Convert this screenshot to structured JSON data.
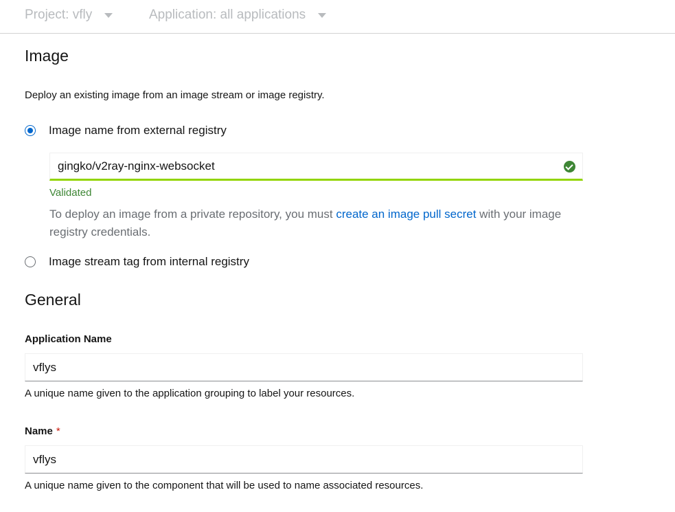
{
  "topbar": {
    "project_label": "Project: vfly",
    "application_label": "Application: all applications"
  },
  "image_section": {
    "title": "Image",
    "description": "Deploy an existing image from an image stream or image registry.",
    "option_external": "Image name from external registry",
    "external_value": "gingko/v2ray-nginx-websocket",
    "validated_text": "Validated",
    "helper_prefix": "To deploy an image from a private repository, you must ",
    "helper_link": "create an image pull secret",
    "helper_suffix": " with your image registry credentials.",
    "option_internal": "Image stream tag from internal registry"
  },
  "general_section": {
    "title": "General",
    "app_name_label": "Application Name",
    "app_name_value": "vflys",
    "app_name_help": "A unique name given to the application grouping to label your resources.",
    "name_label": "Name",
    "name_required_mark": "*",
    "name_value": "vflys",
    "name_help": "A unique name given to the component that will be used to name associated resources."
  },
  "colors": {
    "accent": "#0066cc",
    "success": "#3e8635",
    "valid_border": "#92d400",
    "required": "#c9190b"
  }
}
